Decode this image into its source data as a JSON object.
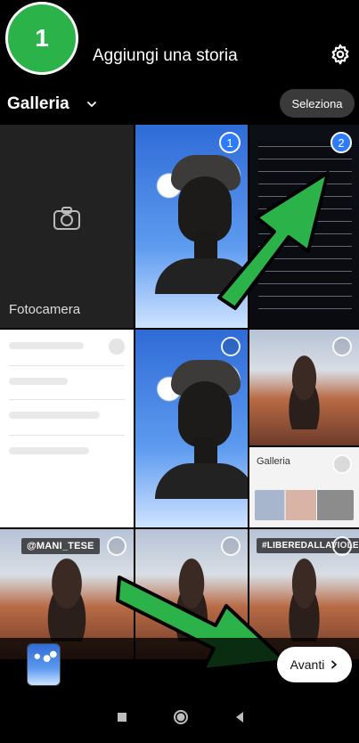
{
  "header": {
    "step_badge": "1",
    "title": "Aggiungi una storia",
    "settings_icon": "settings-icon"
  },
  "gallery": {
    "label": "Galleria",
    "dropdown_icon": "chevron-down-icon",
    "select_button": "Seleziona"
  },
  "grid": {
    "camera_label": "Fotocamera",
    "selected": [
      "1",
      "2"
    ],
    "overlay_labels": [
      "@MANI_TESE",
      "#LIBEREDALLAVIOLENZA"
    ],
    "gallery_tile_title": "Galleria"
  },
  "actions": {
    "avanti": "Avanti"
  },
  "colors": {
    "background": "#000000",
    "accent_green": "#2bb34a",
    "selection_blue": "#2d7cff"
  }
}
